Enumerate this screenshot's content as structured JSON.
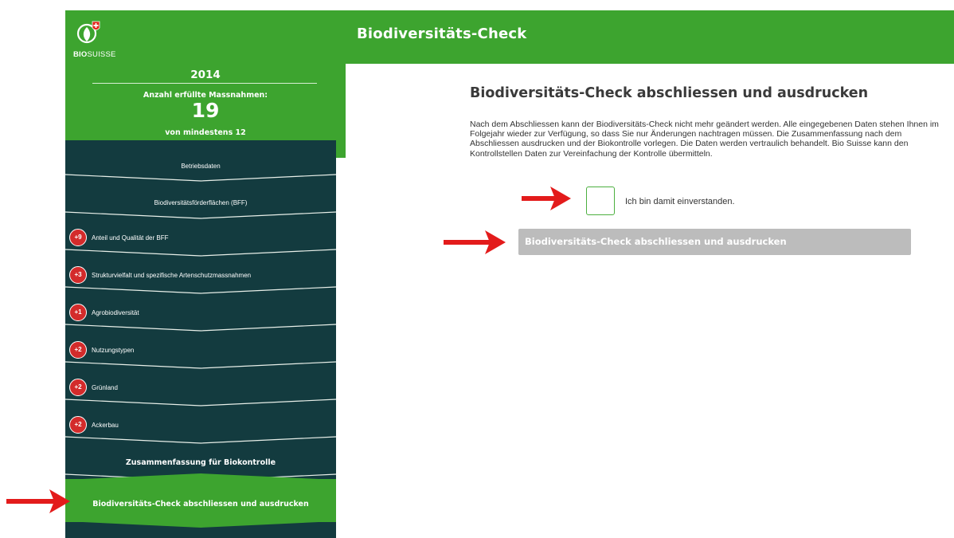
{
  "header": {
    "app_title": "Biodiversitäts-Check",
    "logo_text_bold": "BIO",
    "logo_text": "SUISSE",
    "accent_color": "#3da42f"
  },
  "sidebar": {
    "year": "2014",
    "measures_label": "Anzahl erfüllte Massnahmen:",
    "measures_count": "19",
    "measures_min": "von mindestens 12",
    "nav_bg_color": "#133b3f",
    "badge_color": "#d32b2b",
    "items": [
      {
        "label": "Betriebsdaten",
        "badge": ""
      },
      {
        "label": "Biodiversitätsförderflächen (BFF)",
        "badge": ""
      },
      {
        "label": "Anteil und Qualität der BFF",
        "badge": "+9"
      },
      {
        "label": "Strukturvielfalt und spezifische Artenschutzmassnahmen",
        "badge": "+3"
      },
      {
        "label": "Agrobiodiversität",
        "badge": "+1"
      },
      {
        "label": "Nutzungstypen",
        "badge": "+2"
      },
      {
        "label": "Grünland",
        "badge": "+2"
      },
      {
        "label": "Ackerbau",
        "badge": "+2"
      },
      {
        "label": "Zusammenfassung für Biokontrolle",
        "badge": ""
      },
      {
        "label": "Biodiversitäts-Check abschliessen und ausdrucken",
        "badge": "",
        "active": true
      }
    ]
  },
  "main": {
    "title": "Biodiversitäts-Check abschliessen und ausdrucken",
    "paragraph": "Nach dem Abschliessen kann der Biodiversitäts-Check nicht mehr geändert werden. Alle eingegebenen Daten stehen Ihnen im Folgejahr wieder zur Verfügung, so dass Sie nur Änderungen nachtragen müssen. Die Zusammenfassung nach dem Abschliessen ausdrucken und der Biokontrolle vorlegen. Die Daten werden vertraulich behandelt. Bio Suisse kann den Kontrollstellen Daten zur Vereinfachung der Kontrolle übermitteln.",
    "consent_label": "Ich bin damit einverstanden.",
    "consent_checked": false,
    "submit_label": "Biodiversitäts-Check abschliessen und ausdrucken",
    "submit_color": "#bcbcbc"
  },
  "annotations": {
    "arrow_color": "#e31b1b",
    "arrow_icon": "right-arrow-icon"
  }
}
